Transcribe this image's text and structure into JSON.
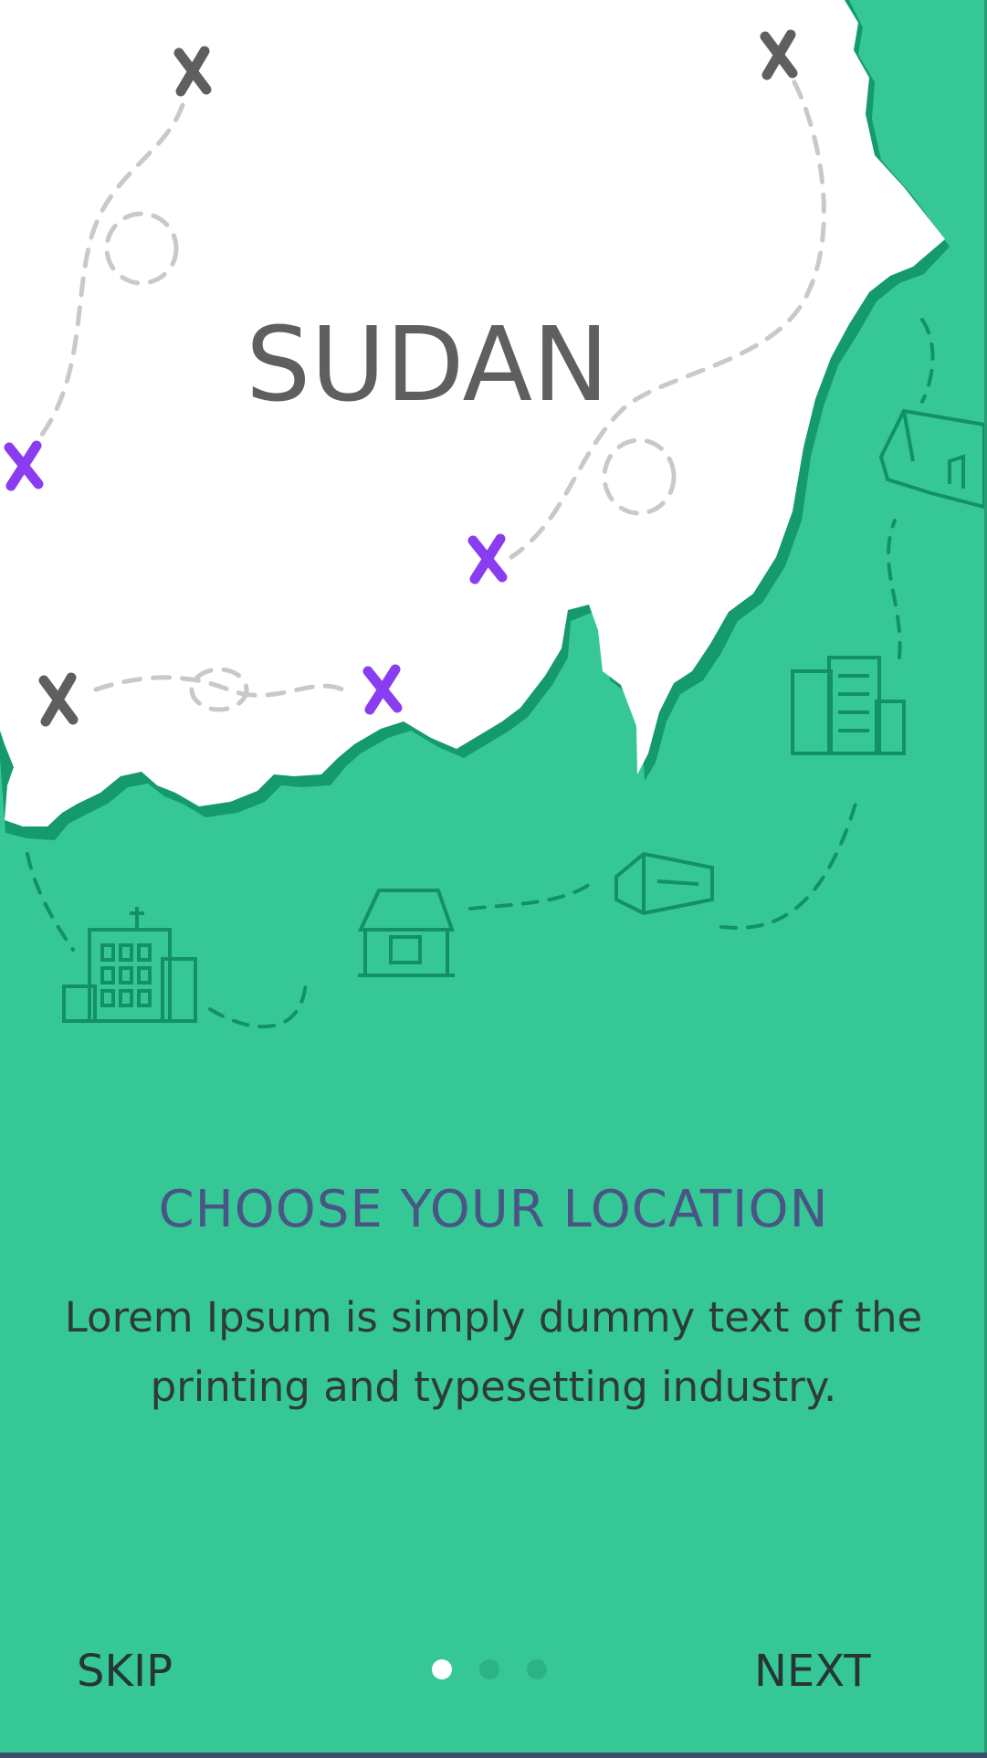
{
  "map": {
    "country_label": "SUDAN"
  },
  "onboarding": {
    "title": "CHOOSE YOUR LOCATION",
    "description": "Lorem Ipsum is simply dummy text of the printing and typesetting industry."
  },
  "footer": {
    "skip_label": "SKIP",
    "next_label": "NEXT",
    "page_indicator": {
      "total": 3,
      "active": 1
    }
  },
  "colors": {
    "background": "#35c896",
    "map_fill": "#ffffff",
    "map_shadow": "#149a6d",
    "marker_dark": "#5f5f5f",
    "marker_accent": "#8a3cf0",
    "title": "#4a5585",
    "body_text": "#2f3a3a"
  },
  "icons": [
    "x-marker-icon",
    "building-icon",
    "house-icon",
    "shop-icon"
  ]
}
